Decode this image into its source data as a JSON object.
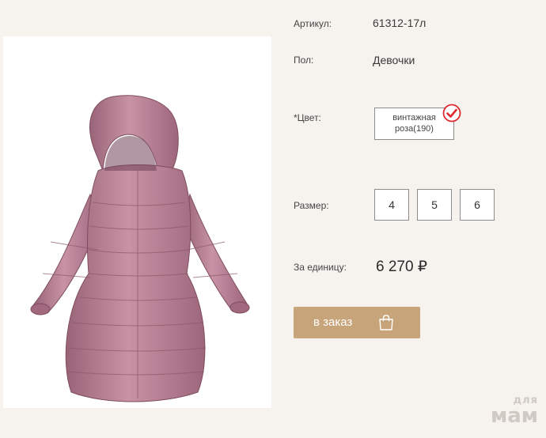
{
  "product": {
    "article_label": "Артикул:",
    "article_value": "61312-17л",
    "gender_label": "Пол:",
    "gender_value": "Девочки",
    "color_label": "*Цвет:",
    "color_value": "винтажная роза(190)",
    "size_label": "Размер:",
    "sizes": [
      "4",
      "5",
      "6"
    ],
    "price_label": "За единицу:",
    "price_value": "6 270 ₽"
  },
  "order_button": {
    "label": "в заказ",
    "icon": "shopping-bag-icon"
  },
  "selected_icon": "checkmark-circle-icon",
  "watermark": {
    "line1": "для",
    "line2": "мам"
  },
  "colors": {
    "accent": "#c8a47a",
    "check": "#e0282e",
    "coat": "#b57f93"
  }
}
